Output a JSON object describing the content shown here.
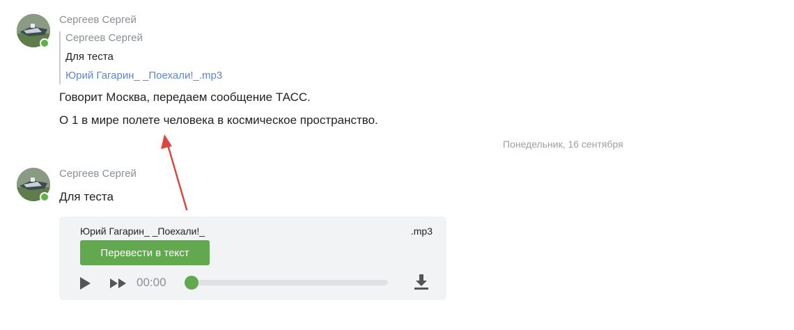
{
  "messages": [
    {
      "author": "Сергеев Сергей",
      "quote": {
        "author": "Сергеев Сергей",
        "text": "Для теста",
        "file": "Юрий Гагарин_ _Поехали!_.mp3"
      },
      "lines": [
        "Говорит Москва, передаем сообщение ТАСС.",
        "О 1 в мире полете человека в космическое пространство."
      ]
    },
    {
      "author": "Сергеев Сергей",
      "text": "Для теста",
      "audio": {
        "filename": "Юрий Гагарин_ _Поехали!_",
        "extension": ".mp3",
        "transcribe_label": "Перевести в текст",
        "time": "00:00",
        "progress": 0,
        "play_icon": "play-icon",
        "forward_icon": "fast-forward-icon",
        "download_icon": "download-icon"
      }
    }
  ],
  "date_separator": "Понедельник, 16 сентября",
  "colors": {
    "online": "#5bb346",
    "link": "#5b86d8",
    "accent_green": "#62a84f",
    "annotation_arrow": "#d9473f"
  }
}
